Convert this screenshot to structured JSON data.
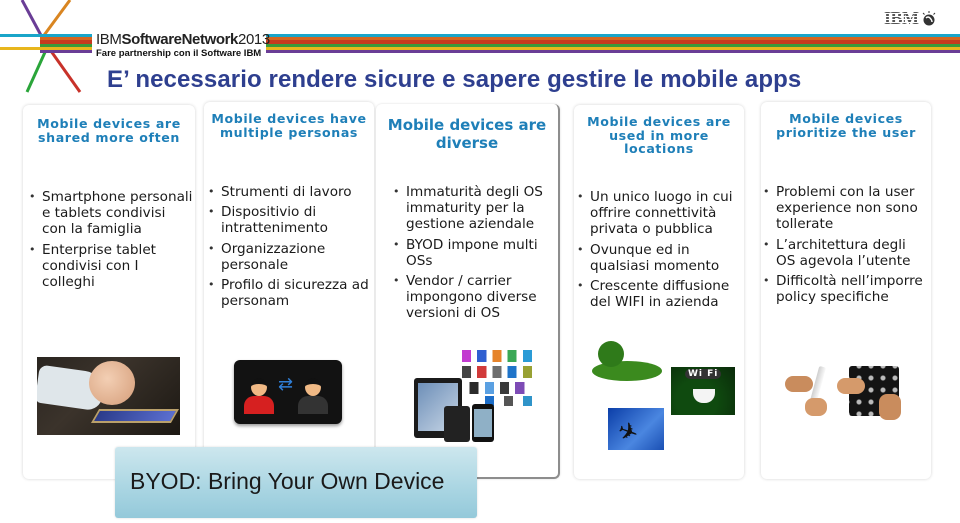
{
  "header": {
    "brand_prefix": "IBM",
    "brand_bold": "SoftwareNetwork",
    "brand_year": "2013",
    "brand_tagline": "Fare partnership con il Software IBM",
    "ibm_logo_text": "IBM",
    "stripe_colors": [
      "#19a5c9",
      "#d5651f",
      "#c63a1e",
      "#3a9a3a",
      "#e8b61c",
      "#6a3d96"
    ],
    "star_colors": [
      "#6a3d96",
      "#d98521",
      "#2aa53a",
      "#c8322a",
      "#19a5c9",
      "#e8b61c"
    ]
  },
  "page_title": "E’ necessario rendere sicure e sapere gestire le mobile apps",
  "colors": {
    "title": "#2e3f8f",
    "card_heading": "#1e7fb8",
    "banner": "#a9d5e2"
  },
  "cards": [
    {
      "heading": "Mobile devices are shared more often",
      "bullets": [
        "Smartphone personali e tablets condivisi con la famiglia",
        "Enterprise tablet condivisi con I colleghi"
      ],
      "image": "baby-using-tablet-photo"
    },
    {
      "heading": "Mobile devices have multiple personas",
      "bullets": [
        "Strumenti di lavoro",
        "Dispositivio di intrattenimento",
        "Organizzazione personale",
        "Profilo di sicurezza ad personam"
      ],
      "image": "tablet-two-personas-illustration"
    },
    {
      "heading": "Mobile devices are diverse",
      "bullets": [
        "Immaturità degli OS immaturity per la gestione aziendale",
        "BYOD impone multi OSs",
        "Vendor / carrier impongono diverse versioni di OS"
      ],
      "image": "devices-and-app-icons-illustration"
    },
    {
      "heading": "Mobile devices are used in more locations",
      "bullets": [
        "Un unico luogo in cui offrire connettività privata o pubblica",
        "Ovunque ed in qualsiasi momento",
        "Crescente diffusione del WIFI in azienda"
      ],
      "image": "park-wifi-airplane-illustrations",
      "wifi_label": "Wi Fi"
    },
    {
      "heading": "Mobile devices prioritize the user",
      "bullets": [
        "Problemi con la user experience non sono tollerate",
        "L’architettura degli OS agevola l’utente",
        "Difficoltà nell’imporre policy specifiche"
      ],
      "image": "hands-using-tablets-photo"
    }
  ],
  "banner": {
    "text": "BYOD: Bring Your Own Device"
  }
}
